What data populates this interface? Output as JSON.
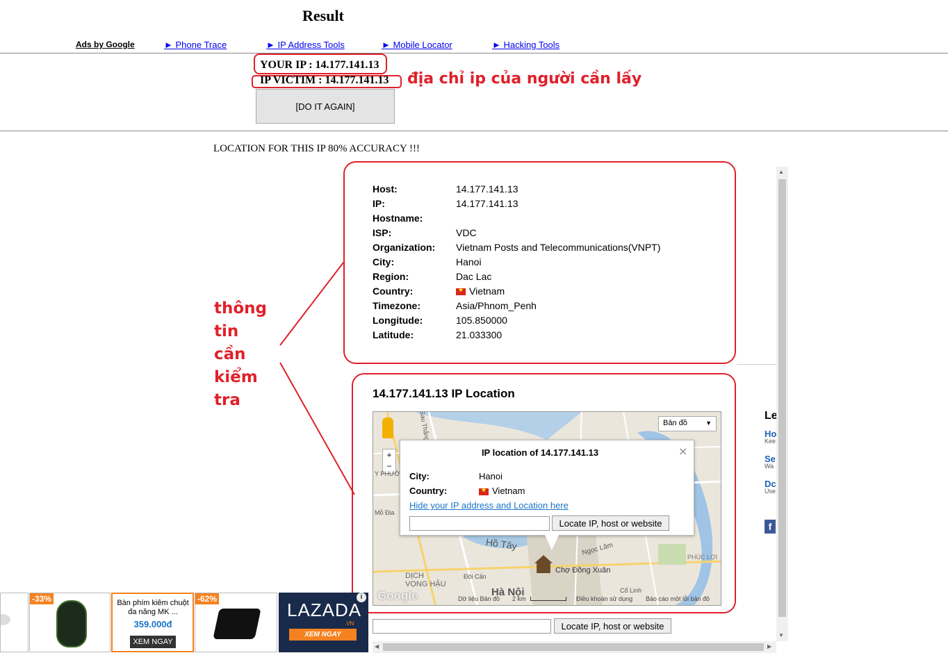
{
  "header": {
    "title": "Result",
    "ads_by": "Ads by Google",
    "nav": [
      "► Phone Trace",
      "► IP Address Tools",
      "► Mobile Locator",
      "► Hacking Tools"
    ]
  },
  "ip": {
    "your_ip": "YOUR IP : 14.177.141.13",
    "victim_ip": "IP VICTIM : 14.177.141.13",
    "do_again": "[DO IT AGAIN]"
  },
  "annotations": {
    "victim_note": "địa chỉ ip của người cần lấy",
    "info_note": [
      "thông",
      "tin",
      "cần",
      "kiểm",
      "tra"
    ]
  },
  "location_heading": "LOCATION FOR THIS IP 80% ACCURACY !!!",
  "info": {
    "rows": [
      {
        "label": "Host:",
        "value": "14.177.141.13"
      },
      {
        "label": "IP:",
        "value": "14.177.141.13"
      },
      {
        "label": "Hostname:",
        "value": ""
      },
      {
        "label": "ISP:",
        "value": "VDC"
      },
      {
        "label": "Organization:",
        "value": "Vietnam Posts and Telecommunications(VNPT)"
      },
      {
        "label": "City:",
        "value": "Hanoi"
      },
      {
        "label": "Region:",
        "value": "Dac Lac"
      },
      {
        "label": "Country:",
        "value": "Vietnam"
      },
      {
        "label": "Timezone:",
        "value": "Asia/Phnom_Penh"
      },
      {
        "label": "Longitude:",
        "value": "105.850000"
      },
      {
        "label": "Latitude:",
        "value": "21.033300"
      }
    ]
  },
  "map_section": {
    "title": "14.177.141.13 IP Location",
    "map_type": "Bản đồ",
    "popup": {
      "title": "IP location of 14.177.141.13",
      "city_label": "City:",
      "city": "Hanoi",
      "country_label": "Country:",
      "country": "Vietnam",
      "hide_link": "Hide your IP address and Location here",
      "locate_btn": "Locate IP, host or website"
    },
    "labels": [
      "Hồ Tây",
      "Chợ Đồng Xuân",
      "Hà Nội",
      "DỊCH VỌNG HẬU",
      "Ngọc Lâm",
      "PHÚC LỢI",
      "Đội Cấn",
      "Cổ Linh",
      "Mỗ Địa",
      "Y PHƯỜNG",
      "Sau Thắng"
    ],
    "footer": [
      "Dữ liệu Bản đồ",
      "2 km",
      "Điều khoản sử dụng",
      "Báo cáo một lỗi bản đồ"
    ],
    "google": "Google",
    "locate_btn": "Locate IP, host or website"
  },
  "sidebar_right": {
    "heading": "Le",
    "items": [
      {
        "t": "Ho",
        "s": "Kee"
      },
      {
        "t": "Se",
        "s": "Wa"
      },
      {
        "t": "Dc",
        "s": "Use"
      }
    ]
  },
  "ads": {
    "items": [
      {
        "badge": "-33%"
      },
      {
        "title": "Bàn phím kiêm chuột đa năng MK ...",
        "price": "359.000đ",
        "cta": "XEM NGAY"
      },
      {
        "badge": "-62%"
      }
    ],
    "lazada": "LAZADA",
    "lazada_vn": ".VN",
    "lazada_cta": "XEM NGAY",
    "info": "i"
  },
  "colors": {
    "annotation": "#e0202a",
    "link": "#0000ee",
    "lazada_bg": "#1a2a4a",
    "badge": "#f58220"
  }
}
